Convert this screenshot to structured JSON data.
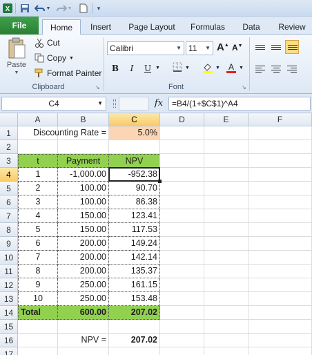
{
  "toolbar": {
    "icons": [
      "excel-app-icon",
      "save-icon",
      "undo-icon",
      "redo-icon",
      "new-document-icon",
      "customize-qat-icon"
    ]
  },
  "tabs": [
    "File",
    "Home",
    "Insert",
    "Page Layout",
    "Formulas",
    "Data",
    "Review"
  ],
  "ribbon": {
    "clipboard": {
      "paste": "Paste",
      "cut": "Cut",
      "copy": "Copy",
      "format_painter": "Format Painter",
      "label": "Clipboard"
    },
    "font": {
      "name": "Calibri",
      "size": "11",
      "bold": "B",
      "italic": "I",
      "underline": "U",
      "label": "Font",
      "font_color": "#e02020",
      "fill_color": "#ffff00"
    }
  },
  "formula_bar": {
    "name_box": "C4",
    "fx": "fx",
    "formula": "=B4/(1+$C$1)^A4"
  },
  "columns": [
    "A",
    "B",
    "C",
    "D",
    "E",
    "F"
  ],
  "rows": [
    "1",
    "2",
    "3",
    "4",
    "5",
    "6",
    "7",
    "8",
    "9",
    "10",
    "11",
    "12",
    "13",
    "14",
    "15",
    "16",
    "17"
  ],
  "sheet": {
    "rate_label": "Discounting Rate =",
    "rate_value": "5.0%",
    "headers": [
      "t",
      "Payment",
      "NPV"
    ],
    "data": [
      [
        "1",
        "-1,000.00",
        "-952.38"
      ],
      [
        "2",
        "100.00",
        "90.70"
      ],
      [
        "3",
        "100.00",
        "86.38"
      ],
      [
        "4",
        "150.00",
        "123.41"
      ],
      [
        "5",
        "150.00",
        "117.53"
      ],
      [
        "6",
        "200.00",
        "149.24"
      ],
      [
        "7",
        "200.00",
        "142.14"
      ],
      [
        "8",
        "200.00",
        "135.37"
      ],
      [
        "9",
        "250.00",
        "161.15"
      ],
      [
        "10",
        "250.00",
        "153.48"
      ]
    ],
    "total": [
      "Total",
      "600.00",
      "207.02"
    ],
    "npv_label": "NPV =",
    "npv_value": "207.02"
  },
  "colors": {
    "header_green": "#92d050",
    "rate_orange": "#fcd5b4",
    "selection_gold": "#f8cb6a",
    "file_tab": "#2a7f35"
  }
}
